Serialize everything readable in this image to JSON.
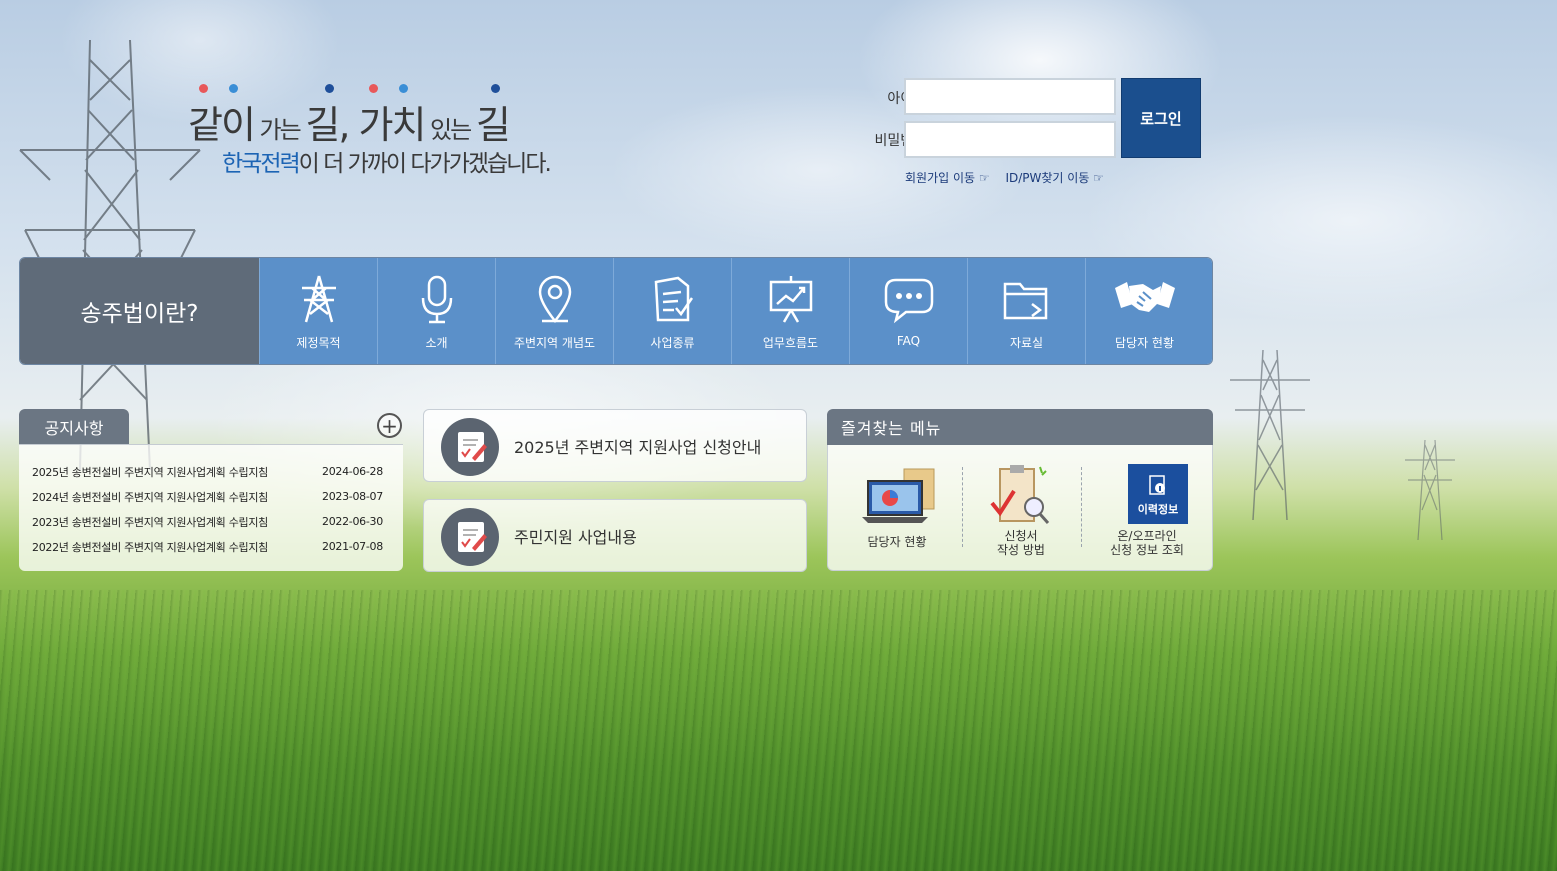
{
  "slogan": {
    "line1": [
      {
        "text": "같이",
        "size": "big"
      },
      {
        "text": " 가는 ",
        "size": "small"
      },
      {
        "text": "길",
        "size": "big"
      },
      {
        "text": ", ",
        "size": "big"
      },
      {
        "text": "가치",
        "size": "big"
      },
      {
        "text": " 있는 ",
        "size": "small"
      },
      {
        "text": "길",
        "size": "big"
      }
    ],
    "brand": "한국전력",
    "line2_rest": "이 더 가까이 다가가겠습니다.",
    "dot_colors": [
      "#e8585a",
      "#3a8ed6",
      "#1f4f9a",
      "#e8585a",
      "#3a8ed6",
      "#1f4f9a"
    ]
  },
  "login": {
    "id_label": "아이디",
    "pw_label": "비밀번호",
    "id_value": "",
    "pw_value": "",
    "button_label": "로그인",
    "signup_link": "회원가입 이동 ☞",
    "find_link": "ID/PW찾기 이동 ☞"
  },
  "menu": {
    "title": "송주법이란?",
    "items": [
      {
        "label": "제정목적",
        "icon": "power-tower-icon"
      },
      {
        "label": "소개",
        "icon": "microphone-icon"
      },
      {
        "label": "주변지역 개념도",
        "icon": "map-pin-icon"
      },
      {
        "label": "사업종류",
        "icon": "document-check-icon"
      },
      {
        "label": "업무흐름도",
        "icon": "presentation-chart-icon"
      },
      {
        "label": "FAQ",
        "icon": "chat-bubble-icon"
      },
      {
        "label": "자료실",
        "icon": "folder-icon"
      },
      {
        "label": "담당자 현황",
        "icon": "handshake-icon"
      }
    ]
  },
  "notice": {
    "title": "공지사항",
    "more_label": "+",
    "rows": [
      {
        "title": "2025년 송변전설비 주변지역 지원사업계획 수립지침",
        "date": "2024-06-28"
      },
      {
        "title": "2024년 송변전설비 주변지역 지원사업계획 수립지침",
        "date": "2023-08-07"
      },
      {
        "title": "2023년 송변전설비 주변지역 지원사업계획 수립지침",
        "date": "2022-06-30"
      },
      {
        "title": "2022년 송변전설비 주변지역 지원사업계획 수립지침",
        "date": "2021-07-08"
      }
    ]
  },
  "quick": [
    {
      "label": "2025년 주변지역 지원사업 신청안내",
      "icon": "document-pen-icon"
    },
    {
      "label": "주민지원 사업내용",
      "icon": "document-pen-icon"
    }
  ],
  "favorites": {
    "title": "즐겨찾는 메뉴",
    "items": [
      {
        "label_lines": [
          "담당자 현황"
        ],
        "icon": "laptop-chart-icon"
      },
      {
        "label_lines": [
          "신청서",
          "작성 방법"
        ],
        "icon": "clipboard-magnifier-icon"
      },
      {
        "label_lines": [
          "온/오프라인",
          "신청 정보 조회"
        ],
        "icon": "info-badge-icon",
        "badge_text": "이력정보"
      }
    ]
  },
  "colors": {
    "login_button": "#1b4f8e",
    "menu_title_bg": "#5f6b79",
    "menu_items_bg": "#5b90c9",
    "brand_blue": "#1c64b4"
  }
}
